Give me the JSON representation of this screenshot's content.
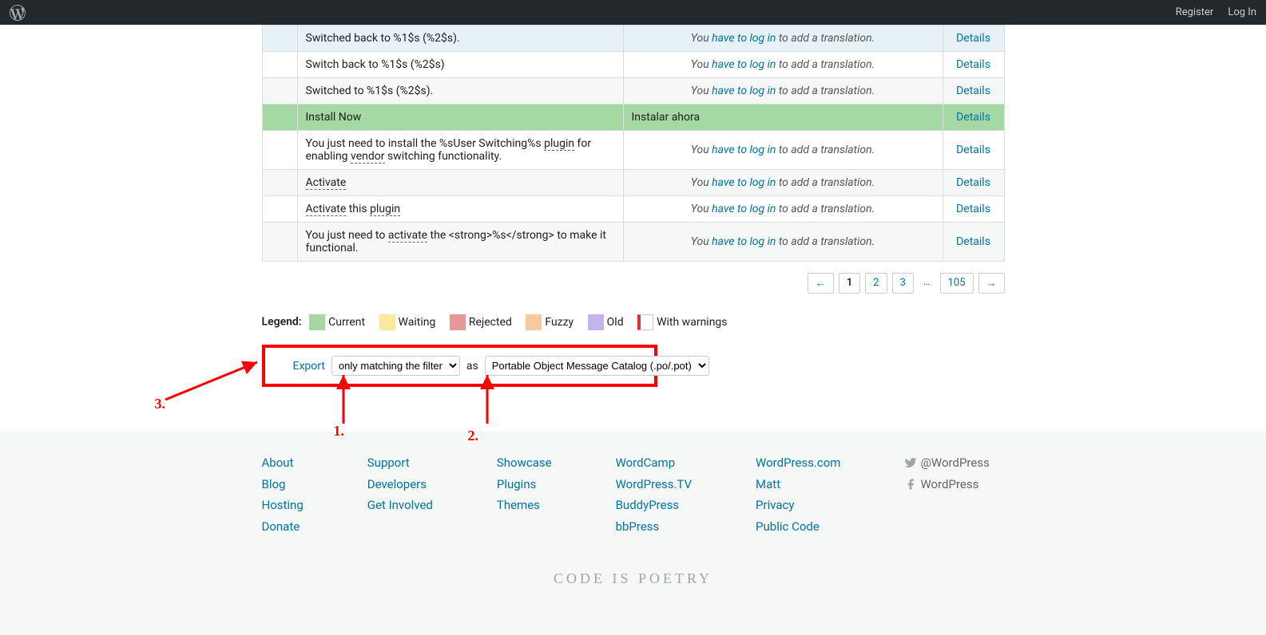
{
  "header": {
    "register": "Register",
    "login": "Log In"
  },
  "rows": [
    {
      "cls": "fuzzy",
      "original": "Switched back to %1$s (%2$s).",
      "needs_login": true
    },
    {
      "cls": "untranslated odd",
      "original": "Switch back to %1$s (%2$s)",
      "needs_login": true
    },
    {
      "cls": "untranslated even",
      "original": "Switched to %1$s (%2$s).",
      "needs_login": true
    },
    {
      "cls": "current",
      "original": "Install Now",
      "translation": "Instalar ahora"
    },
    {
      "cls": "untranslated odd",
      "original_html": "You just need to install the %sUser Switching%s <span class=\"glossary\">plugin</span> for enabling <span class=\"glossary\">vendor</span> switching functionality.",
      "needs_login": true
    },
    {
      "cls": "untranslated even",
      "original_html": "<span class=\"glossary\">Activate</span>",
      "needs_login": true
    },
    {
      "cls": "untranslated odd",
      "original_html": "<span class=\"glossary\">Activate</span> this <span class=\"glossary\">plugin</span>",
      "needs_login": true
    },
    {
      "cls": "untranslated even",
      "original_html": "You just need to <span class=\"glossary\">activate</span> the &lt;strong&gt;%s&lt;/strong&gt; to make it functional.",
      "needs_login": true
    }
  ],
  "login_msg": {
    "prefix": "You ",
    "link": "have to log in",
    "suffix": " to add a translation."
  },
  "details": "Details",
  "pagination": {
    "prev": "←",
    "current": "1",
    "p2": "2",
    "p3": "3",
    "dots": "…",
    "last": "105",
    "next": "→"
  },
  "legend": {
    "title": "Legend:",
    "current": "Current",
    "waiting": "Waiting",
    "rejected": "Rejected",
    "fuzzy": "Fuzzy",
    "old": "Old",
    "warnings": "With warnings"
  },
  "export": {
    "link": "Export",
    "scope": "only matching the filter",
    "as": "as",
    "format": "Portable Object Message Catalog (.po/.pot)"
  },
  "footer": {
    "col1": [
      "About",
      "Blog",
      "Hosting",
      "Donate"
    ],
    "col2": [
      "Support",
      "Developers",
      "Get Involved"
    ],
    "col3": [
      "Showcase",
      "Plugins",
      "Themes"
    ],
    "col4": [
      "WordCamp",
      "WordPress.TV",
      "BuddyPress",
      "bbPress"
    ],
    "col5": [
      "WordPress.com",
      "Matt",
      "Privacy",
      "Public Code"
    ],
    "twitter": "@WordPress",
    "facebook": "WordPress",
    "tagline": "Code is Poetry"
  },
  "anno": {
    "n1": "1.",
    "n2": "2.",
    "n3": "3."
  }
}
